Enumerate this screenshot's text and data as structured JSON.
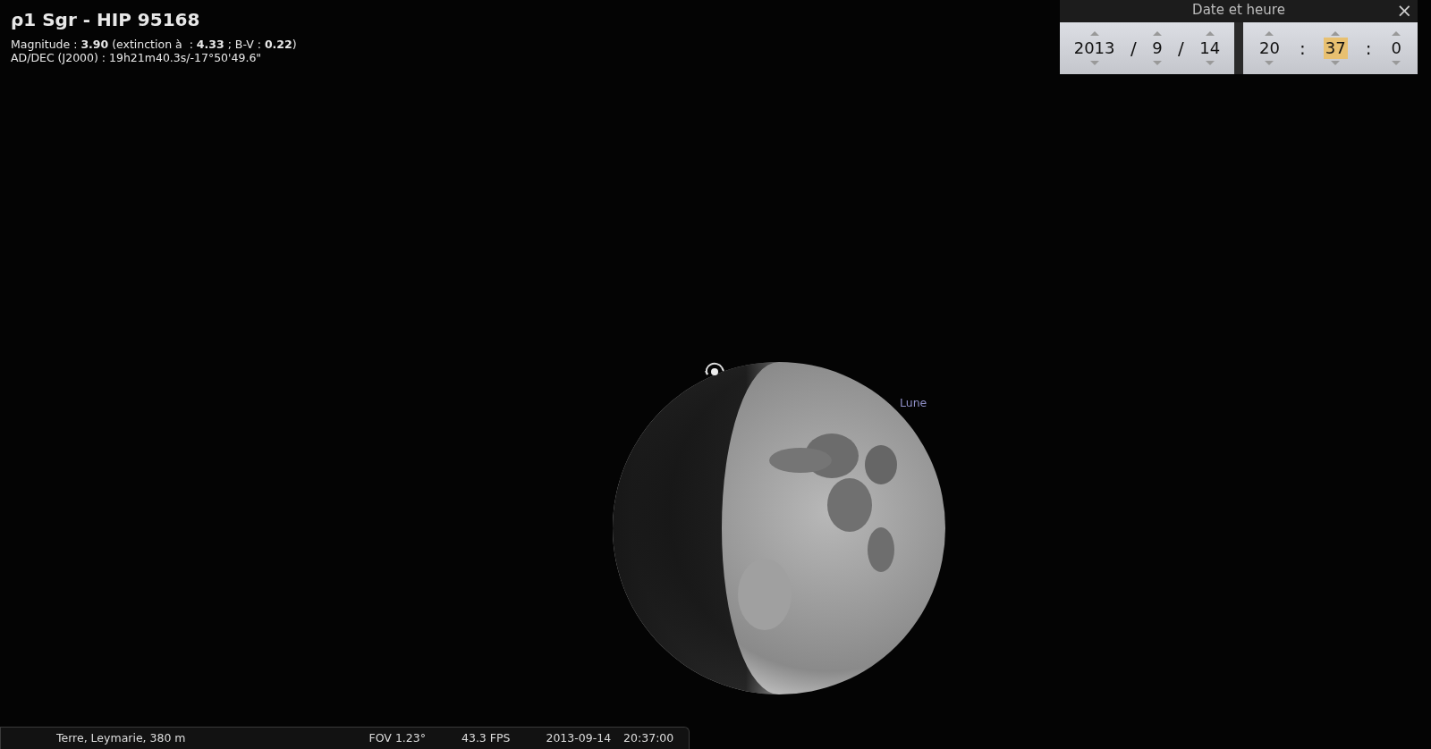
{
  "object_info": {
    "title": "ρ1 Sgr - HIP 95168",
    "lines": [
      "Magnitude : **3.90** (extinction à  : **4.33** ; B-V : **0.22**)",
      "AD/DEC (J2000) : 19h21m40.3s/-17°50'49.6\""
    ]
  },
  "sky": {
    "moon_label": "Lune"
  },
  "date_dialog": {
    "title": "Date et heure",
    "close": "×",
    "groups": [
      {
        "fields": [
          {
            "value": "2013",
            "selected": false
          },
          {
            "value": "9",
            "selected": false
          },
          {
            "value": "14",
            "selected": false
          }
        ],
        "separators": [
          "/",
          "/"
        ]
      },
      {
        "fields": [
          {
            "value": "20",
            "selected": false
          },
          {
            "value": "37",
            "selected": true
          },
          {
            "value": "0",
            "selected": false
          }
        ],
        "separators": [
          ":",
          ":"
        ]
      }
    ]
  },
  "status_bar": {
    "location": "Terre, Leymarie, 380 m",
    "fov": "FOV 1.23°",
    "fps": "43.3 FPS",
    "date": "2013-09-14",
    "time": "20:37:00"
  }
}
